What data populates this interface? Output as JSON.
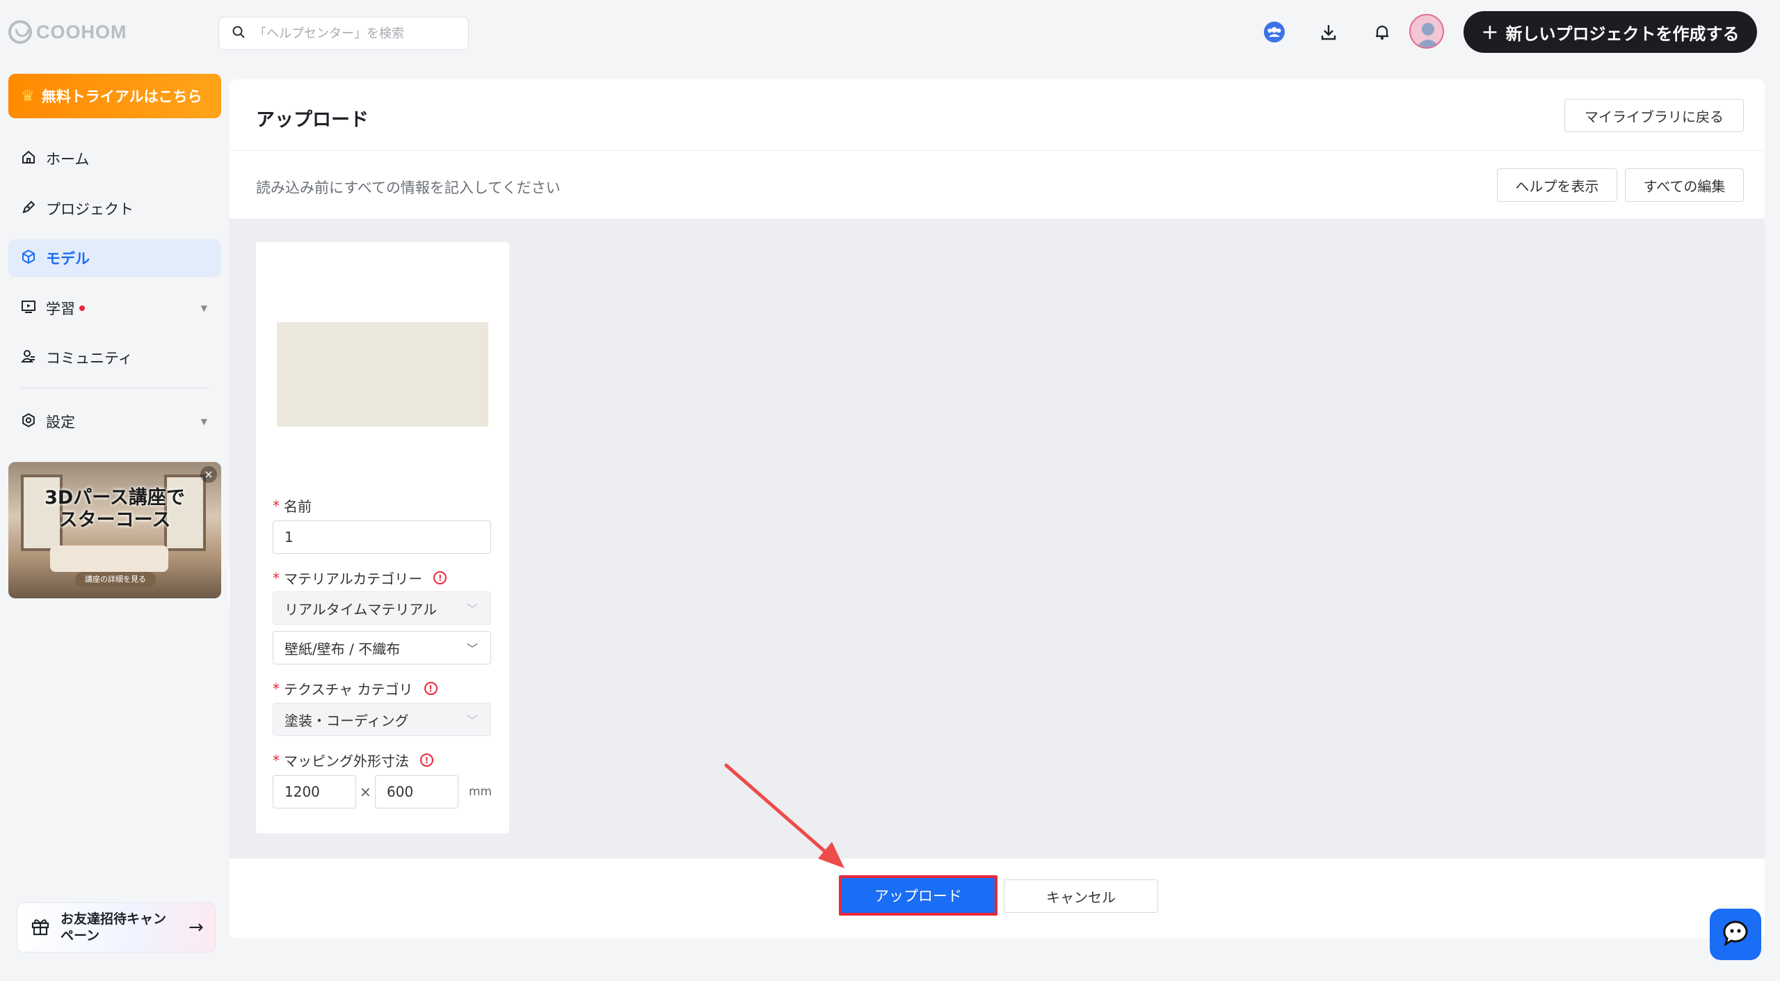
{
  "brand": {
    "logo_text": "COOHOM"
  },
  "search": {
    "placeholder": "「ヘルプセンター」を検索"
  },
  "top_actions": {
    "new_project_label": "新しいプロジェクトを作成する"
  },
  "sidebar": {
    "trial_label": "無料トライアルはこちら",
    "items": [
      {
        "label": "ホーム",
        "icon": "home-icon",
        "active": false
      },
      {
        "label": "プロジェクト",
        "icon": "pencil-icon",
        "active": false
      },
      {
        "label": "モデル",
        "icon": "cube-icon",
        "active": true
      },
      {
        "label": "学習",
        "icon": "video-icon",
        "active": false
      },
      {
        "label": "コミュニティ",
        "icon": "people-icon",
        "active": false
      },
      {
        "label": "設定",
        "icon": "gear-icon",
        "active": false
      }
    ],
    "banner": {
      "title_line1": "3Dパース講座で",
      "title_line2": "スターコース",
      "cta": "講座の詳細を見る"
    },
    "invite_label": "お友達招待キャンペーン"
  },
  "page": {
    "title": "アップロード",
    "back_button": "マイライブラリに戻る",
    "subtitle": "読み込み前にすべての情報を記入してください",
    "help_button": "ヘルプを表示",
    "edit_all_button": "すべての編集"
  },
  "form": {
    "name_label": "名前",
    "name_value": "1",
    "material_category_label": "マテリアルカテゴリー",
    "material_type_value": "リアルタイムマテリアル",
    "material_sub_value": "壁紙/壁布 / 不織布",
    "texture_category_label": "テクスチャ カテゴリ",
    "texture_value": "塗装・コーディング",
    "mapping_label": "マッピング外形寸法",
    "width_value": "1200",
    "height_value": "600",
    "times_symbol": "×",
    "unit": "mm",
    "required_mark": "*"
  },
  "footer": {
    "upload_button": "アップロード",
    "cancel_button": "キャンセル"
  },
  "colors": {
    "primary": "#1a6df5",
    "highlight_red": "#e8273b",
    "trial_orange": "#ff8a00",
    "dark_button": "#1c1d21"
  }
}
